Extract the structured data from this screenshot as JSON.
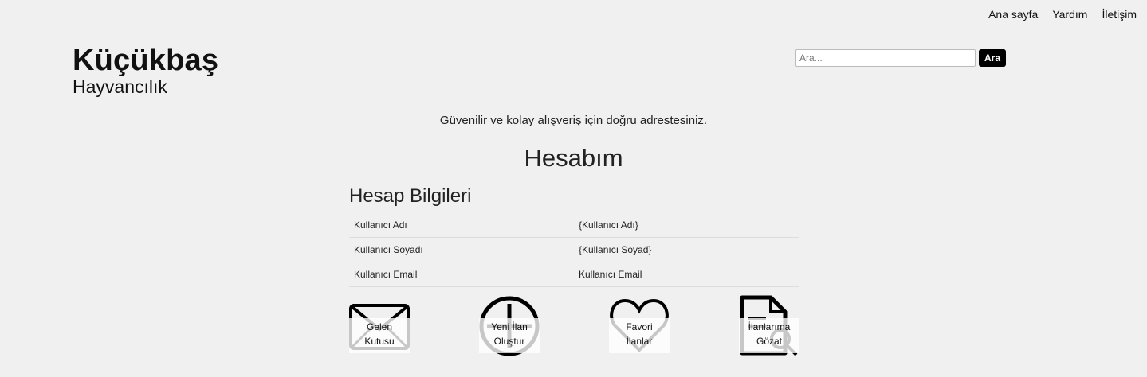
{
  "nav": {
    "home": "Ana sayfa",
    "help": "Yardım",
    "contact": "İletişim"
  },
  "brand": {
    "title": "Küçükbaş",
    "subtitle": "Hayvancılık"
  },
  "search": {
    "placeholder": "Ara...",
    "button": "Ara"
  },
  "tagline": "Güvenilir ve kolay alışveriş için doğru adrestesiniz.",
  "page_title": "Hesabım",
  "account": {
    "title": "Hesap Bilgileri",
    "rows": [
      {
        "label": "Kullanıcı Adı",
        "value": "{Kullanıcı Adı}"
      },
      {
        "label": "Kullanıcı Soyadı",
        "value": "{Kullanıcı Soyad}"
      },
      {
        "label": "Kullanıcı Email",
        "value": "Kullanıcı Email"
      }
    ]
  },
  "actions": [
    {
      "line1": "Gelen",
      "line2": "Kutusu",
      "icon": "envelope-icon"
    },
    {
      "line1": "Yeni İlan",
      "line2": "Oluştur",
      "icon": "plus-circle-icon"
    },
    {
      "line1": "Favori",
      "line2": "İlanlar",
      "icon": "heart-icon"
    },
    {
      "line1": "İlanlarıma",
      "line2": "Gözat",
      "icon": "document-search-icon"
    }
  ]
}
